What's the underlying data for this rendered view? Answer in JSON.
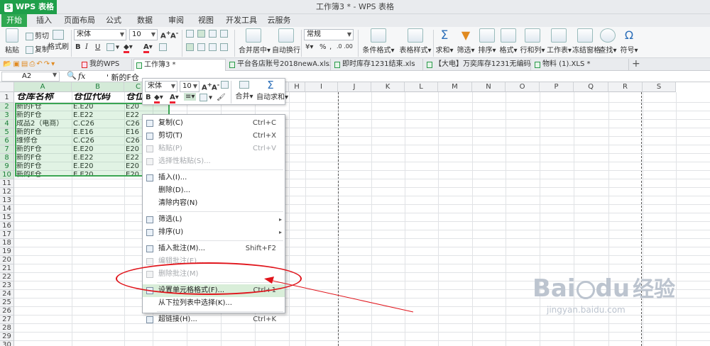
{
  "app": {
    "menu_label": "WPS 表格",
    "logo": "S",
    "title": "工作簿3 * - WPS 表格"
  },
  "menu_tabs": [
    "开始",
    "插入",
    "页面布局",
    "公式",
    "数据",
    "审阅",
    "视图",
    "开发工具",
    "云服务"
  ],
  "ribbon": {
    "paste": "粘贴",
    "cut": "剪切",
    "copy": "复制",
    "format_painter": "格式刷",
    "font_name": "宋体",
    "font_size": "10",
    "merge_center": "合并居中",
    "wrap_text": "自动换行",
    "number_format": "常规",
    "conditional_format": "条件格式",
    "table_style": "表格样式",
    "sum": "求和",
    "filter": "筛选",
    "sort": "排序",
    "format": "格式",
    "row_col": "行和列",
    "worksheet": "工作表",
    "freeze": "冻结窗格",
    "find": "查找",
    "symbol": "符号"
  },
  "doc_tabs": [
    "我的WPS",
    "工作簿3 *",
    "平台各店账号2018newA.xlsx *",
    "即时库存1231结束.xls",
    "【大电】万奕库存1231无编码.xls *",
    "物料 (1).XLS *"
  ],
  "formula_bar": {
    "name_box": "A2",
    "fx": "fx",
    "content": "' 新的F仓"
  },
  "columns": [
    "A",
    "B",
    "C",
    "D",
    "E",
    "F",
    "G",
    "H",
    "I",
    "J",
    "K",
    "L",
    "M",
    "N",
    "O",
    "P",
    "Q",
    "R",
    "S"
  ],
  "rows": [
    "1",
    "2",
    "3",
    "4",
    "5",
    "6",
    "7",
    "8",
    "9",
    "10",
    "11",
    "12",
    "13",
    "14",
    "15",
    "16",
    "17",
    "18",
    "19",
    "20",
    "21",
    "22",
    "23",
    "24",
    "25",
    "26",
    "27",
    "28",
    "29",
    "30"
  ],
  "sheet": {
    "header": [
      "仓库名称",
      "仓位代码",
      "仓位"
    ],
    "data": [
      [
        "新的F仓",
        "E.E20",
        "E20"
      ],
      [
        "新的F仓",
        "E.E22",
        "E22"
      ],
      [
        "成品2（电商）",
        "C.C26",
        "C26"
      ],
      [
        "新的F仓",
        "E.E16",
        "E16"
      ],
      [
        "维修仓",
        "C.C26",
        "C26"
      ],
      [
        "新的F仓",
        "E.E20",
        "E20"
      ],
      [
        "新的F仓",
        "E.E22",
        "E22"
      ],
      [
        "新的F仓",
        "E.E20",
        "E20"
      ],
      [
        "新的F仓",
        "E.E20",
        "E20"
      ]
    ]
  },
  "mini_toolbar": {
    "font_name": "宋体",
    "font_size": "10",
    "bold": "B",
    "merge": "合并",
    "autosum": "自动求和"
  },
  "context_menu": [
    {
      "label": "复制(C)",
      "shortcut": "Ctrl+C",
      "icon": "copy-icon",
      "disabled": false
    },
    {
      "label": "剪切(T)",
      "shortcut": "Ctrl+X",
      "icon": "scissors-icon",
      "disabled": false
    },
    {
      "label": "粘贴(P)",
      "shortcut": "Ctrl+V",
      "icon": "paste-icon",
      "disabled": true
    },
    {
      "label": "选择性粘贴(S)...",
      "shortcut": "",
      "icon": "paste-special-icon",
      "disabled": true
    },
    {
      "sep": true
    },
    {
      "label": "插入(I)...",
      "shortcut": "",
      "icon": "insert-icon",
      "disabled": false
    },
    {
      "label": "删除(D)...",
      "shortcut": "",
      "icon": "",
      "disabled": false
    },
    {
      "label": "清除内容(N)",
      "shortcut": "",
      "icon": "",
      "disabled": false
    },
    {
      "sep": true
    },
    {
      "label": "筛选(L)",
      "shortcut": "",
      "icon": "filter-icon",
      "disabled": false,
      "submenu": true
    },
    {
      "label": "排序(U)",
      "shortcut": "",
      "icon": "sort-icon",
      "disabled": false,
      "submenu": true
    },
    {
      "sep": true
    },
    {
      "label": "插入批注(M)...",
      "shortcut": "Shift+F2",
      "icon": "comment-icon",
      "disabled": false
    },
    {
      "label": "编辑批注(E)...",
      "shortcut": "",
      "icon": "edit-comment-icon",
      "disabled": true
    },
    {
      "label": "删除批注(M)",
      "shortcut": "",
      "icon": "delete-comment-icon",
      "disabled": true
    },
    {
      "sep": true
    },
    {
      "label": "设置单元格格式(F)...",
      "shortcut": "Ctrl+1",
      "icon": "format-cells-icon",
      "disabled": false,
      "highlight": true
    },
    {
      "label": "从下拉列表中选择(K)...",
      "shortcut": "",
      "icon": "",
      "disabled": false
    },
    {
      "sep": true
    },
    {
      "label": "超链接(H)...",
      "shortcut": "Ctrl+K",
      "icon": "hyperlink-icon",
      "disabled": false
    }
  ],
  "watermark": {
    "brand": "Bai",
    "brand2": "du",
    "cn": "经验",
    "url": "jingyan.baidu.com"
  },
  "colors": {
    "accent": "#2fa851",
    "selection": "#3aa552",
    "annotation": "#e0141b"
  }
}
